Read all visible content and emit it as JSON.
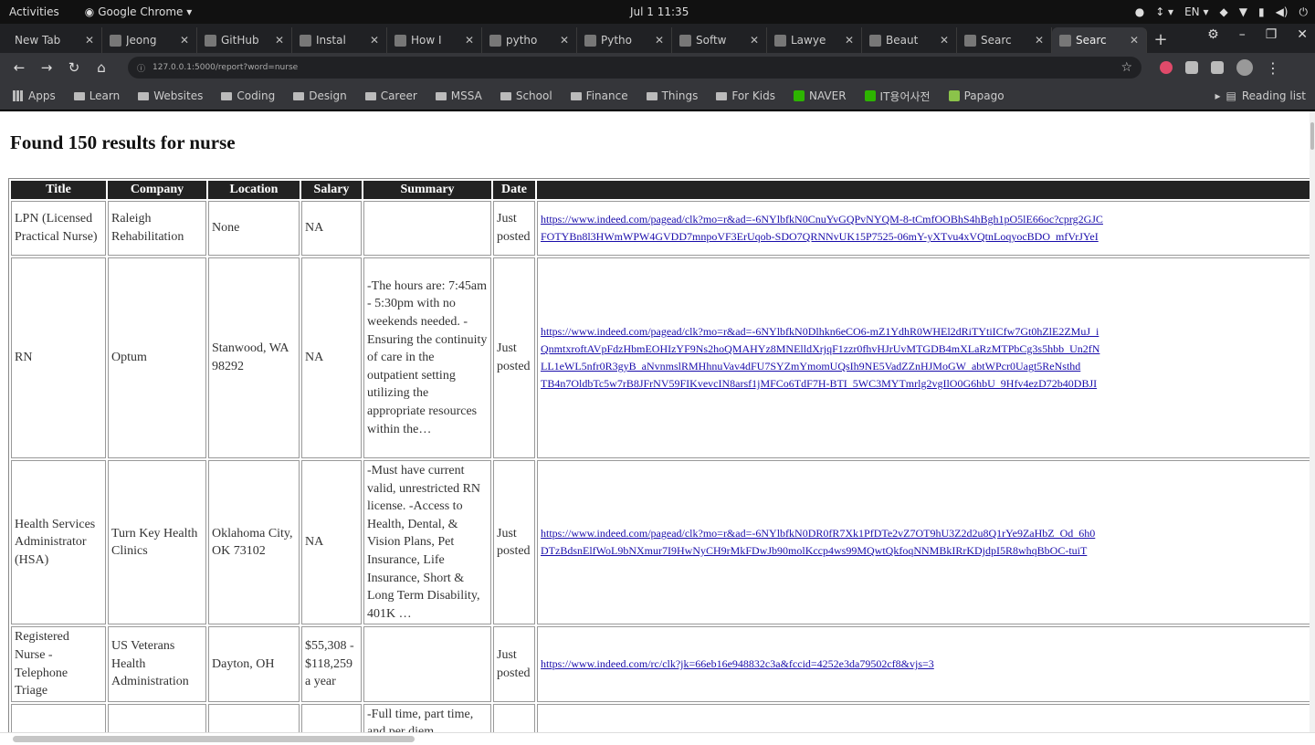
{
  "topbar": {
    "activities": "Activities",
    "app": "Google Chrome ▾",
    "clock": "Jul 1  11:35",
    "lang": "EN ▾"
  },
  "tabs": [
    {
      "label": "New Tab"
    },
    {
      "label": "Jeong"
    },
    {
      "label": "GitHub"
    },
    {
      "label": "Instal"
    },
    {
      "label": "How I"
    },
    {
      "label": "pytho"
    },
    {
      "label": "Pytho"
    },
    {
      "label": "Softw"
    },
    {
      "label": "Lawye"
    },
    {
      "label": "Beaut"
    },
    {
      "label": "Searc"
    },
    {
      "label": "Searc"
    }
  ],
  "toolbar": {
    "url": "127.0.0.1:5000/report?word=nurse"
  },
  "bookmarks": {
    "items": [
      "Apps",
      "Learn",
      "Websites",
      "Coding",
      "Design",
      "Career",
      "MSSA",
      "School",
      "Finance",
      "Things",
      "For Kids",
      "NAVER",
      "IT용어사전",
      "Papago"
    ],
    "reading_list": "Reading list"
  },
  "page": {
    "heading": "Found 150 results for nurse",
    "columns": [
      "Title",
      "Company",
      "Location",
      "Salary",
      "Summary",
      "Date",
      ""
    ],
    "rows": [
      {
        "title": "LPN (Licensed Practical Nurse)",
        "company": "Raleigh Rehabilitation",
        "location": "None",
        "salary": "NA",
        "summary": "",
        "date": "Just posted",
        "links": [
          "https://www.indeed.com/pagead/clk?mo=r&ad=-6NYlbfkN0CnuYvGQPvNYQM-8-tCmfOOBhS4hBgh1pO5lE66oc?cprg2GJC",
          "FOTYBn8l3HWmWPW4GVDD7mnpoVF3ErUqob-SDO7QRNNvUK15P7525-06mY-yXTvu4xVQtnLoqyocBDO_mfVrJYeI"
        ]
      },
      {
        "title": "RN",
        "company": "Optum",
        "location": "Stanwood, WA 98292",
        "salary": "NA",
        "summary": "-The hours are: 7:45am - 5:30pm with no weekends needed. -Ensuring the continuity of care in the outpatient setting utilizing the appropriate resources within the…",
        "date": "Just posted",
        "links": [
          "https://www.indeed.com/pagead/clk?mo=r&ad=-6NYlbfkN0Dlhkn6eCO6-mZ1YdhR0WHEl2dRiTYtiICfw7Gt0hZlE2ZMuJ_i",
          "QnmtxroftAVpFdzHbmEOHIzYF9Ns2hoQMAHYz8MNElldXrjqF1zzr0fhvHJrUvMTGDB4mXLaRzMTPbCg3s5hbb_Un2fN",
          "LL1eWL5nfr0R3gyB_aNvnmslRMHhnuVav4dFU7SYZmYmomUQsIh9NE5VadZZnHJMoGW_abtWPcr0Uagt5ReNsthd",
          "TB4n7OldbTc5w7rB8JFrNV59FIKvevcIN8arsf1jMFCo6TdF7H-BTI_5WC3MYTmrlg2vgIlO0G6hbU_9Hfv4ezD72b40DBJI"
        ]
      },
      {
        "title": "Health Services Administrator (HSA)",
        "company": "Turn Key Health Clinics",
        "location": "Oklahoma City, OK 73102",
        "salary": "NA",
        "summary": "-Must have current valid, unrestricted RN license. -Access to Health, Dental, & Vision Plans, Pet Insurance, Life Insurance, Short & Long Term Disability, 401K …",
        "date": "Just posted",
        "links": [
          "https://www.indeed.com/pagead/clk?mo=r&ad=-6NYlbfkN0DR0fR7Xk1PfDTe2vZ7OT9hU3Z2d2u8Q1rYe9ZaHbZ_Od_6h0",
          "DTzBdsnElfWoL9bNXmur7I9HwNyCH9rMkFDwJb90molKccp4ws99MQwtQkfoqNNMBkIRrKDjdpI5R8whqBbOC-tuiT"
        ]
      },
      {
        "title": "Registered Nurse - Telephone Triage",
        "company": "US Veterans Health Administration",
        "location": "Dayton, OH",
        "salary": "$55,308 - $118,259 a year",
        "summary": "",
        "date": "Just posted",
        "links": [
          "https://www.indeed.com/rc/clk?jk=66eb16e948832c3a&fccid=4252e3da79502cf8&vjs=3"
        ]
      },
      {
        "title": "",
        "company": "",
        "location": "",
        "salary": "",
        "summary": "-Full time, part time, and per diem",
        "date": "",
        "links": []
      }
    ]
  }
}
